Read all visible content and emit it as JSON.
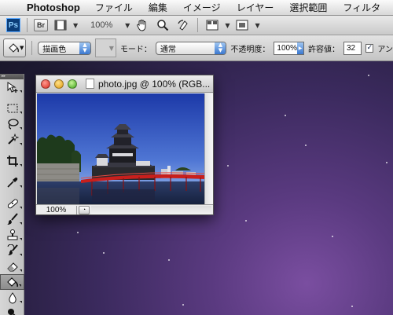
{
  "menubar": {
    "apple_icon": "apple-icon",
    "app_name": "Photoshop",
    "items": [
      "ファイル",
      "編集",
      "イメージ",
      "レイヤー",
      "選択範囲",
      "フィルタ"
    ]
  },
  "appbar": {
    "ps_logo": "Ps",
    "bridge_label": "Br",
    "zoom_value": "100%"
  },
  "options": {
    "fill_source": "描画色",
    "mode_label": "モード：",
    "mode_value": "通常",
    "opacity_label": "不透明度：",
    "opacity_value": "100%",
    "tolerance_label": "許容値：",
    "tolerance_value": "32",
    "antialias_label": "アン",
    "antialias_checked": true
  },
  "tools": [
    "move-tool",
    "marquee-tool",
    "lasso-tool",
    "quick-select-tool",
    "crop-tool",
    "eyedropper-tool",
    "healing-brush-tool",
    "brush-tool",
    "clone-stamp-tool",
    "history-brush-tool",
    "eraser-tool",
    "paint-bucket-tool",
    "blur-tool",
    "dodge-tool"
  ],
  "active_tool": "paint-bucket-tool",
  "document": {
    "title": "photo.jpg @ 100% (RGB...",
    "zoom_status": "100%"
  },
  "colors": {
    "sky_top": "#1f3fae",
    "sky_bottom": "#8fb3ea",
    "bridge_red": "#c81f1c",
    "desktop_purple": "#5a3a80"
  }
}
